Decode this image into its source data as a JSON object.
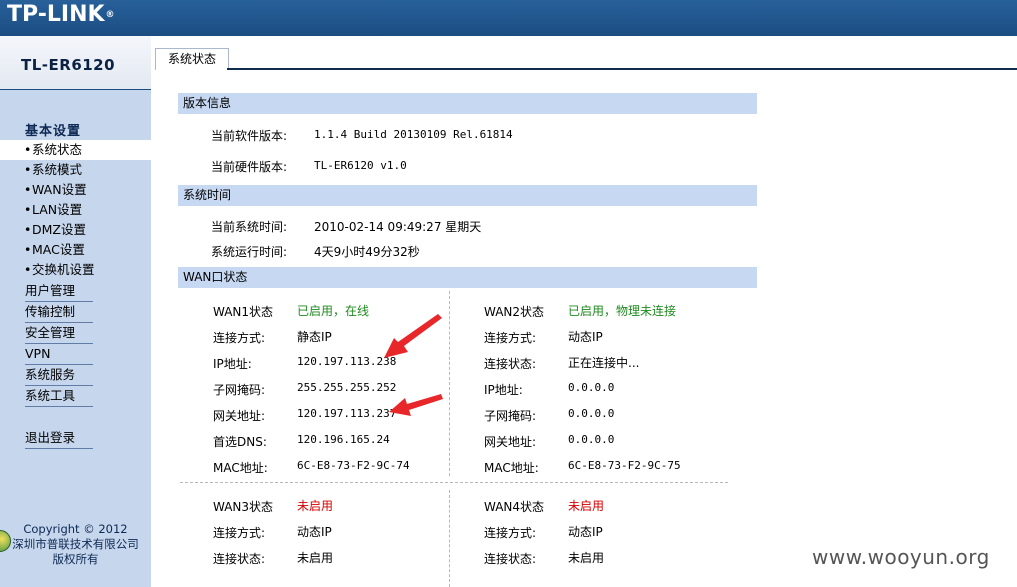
{
  "brand": {
    "logo": "TP-LINK",
    "reg": "®",
    "model": "TL-ER6120"
  },
  "tab": {
    "label": "系统状态"
  },
  "sidebar": {
    "heading": "基本设置",
    "sub_items": [
      {
        "label": "系统状态"
      },
      {
        "label": "系统模式"
      },
      {
        "label": "WAN设置"
      },
      {
        "label": "LAN设置"
      },
      {
        "label": "DMZ设置"
      },
      {
        "label": "MAC设置"
      },
      {
        "label": "交换机设置"
      }
    ],
    "main_items": [
      {
        "label": "用户管理"
      },
      {
        "label": "传输控制"
      },
      {
        "label": "安全管理"
      },
      {
        "label": "VPN"
      },
      {
        "label": "系统服务"
      },
      {
        "label": "系统工具"
      }
    ],
    "logout": "退出登录",
    "copyright_line1": "Copyright ©  2012",
    "copyright_line2": "深圳市普联技术有限公司",
    "copyright_line3": "版权所有",
    "bullet": "•"
  },
  "version": {
    "title": "版本信息",
    "software_label": "当前软件版本:",
    "software_value": "1.1.4 Build 20130109 Rel.61814",
    "hardware_label": "当前硬件版本:",
    "hardware_value": "TL-ER6120 v1.0"
  },
  "time": {
    "title": "系统时间",
    "current_label": "当前系统时间:",
    "current_value": "2010-02-14 09:49:27 星期天",
    "uptime_label": "系统运行时间:",
    "uptime_value": "4天9小时49分32秒"
  },
  "wan": {
    "title": "WAN口状态",
    "wan1": {
      "status_label": "WAN1状态",
      "status_value": "已启用，在线",
      "conn_type_label": "连接方式:",
      "conn_type_value": "静态IP",
      "ip_label": "IP地址:",
      "ip_value": "120.197.113.238",
      "mask_label": "子网掩码:",
      "mask_value": "255.255.255.252",
      "gw_label": "网关地址:",
      "gw_value": "120.197.113.237",
      "dns_label": "首选DNS:",
      "dns_value": "120.196.165.24",
      "mac_label": "MAC地址:",
      "mac_value": "6C-E8-73-F2-9C-74"
    },
    "wan2": {
      "status_label": "WAN2状态",
      "status_value": "已启用，物理未连接",
      "conn_type_label": "连接方式:",
      "conn_type_value": "动态IP",
      "conn_state_label": "连接状态:",
      "conn_state_value": "正在连接中...",
      "ip_label": "IP地址:",
      "ip_value": "0.0.0.0",
      "mask_label": "子网掩码:",
      "mask_value": "0.0.0.0",
      "gw_label": "网关地址:",
      "gw_value": "0.0.0.0",
      "mac_label": "MAC地址:",
      "mac_value": "6C-E8-73-F2-9C-75"
    },
    "wan3": {
      "status_label": "WAN3状态",
      "status_value": "未启用",
      "conn_type_label": "连接方式:",
      "conn_type_value": "动态IP",
      "conn_state_label": "连接状态:",
      "conn_state_value": "未启用"
    },
    "wan4": {
      "status_label": "WAN4状态",
      "status_value": "未启用",
      "conn_type_label": "连接方式:",
      "conn_type_value": "动态IP",
      "conn_state_label": "连接状态:",
      "conn_state_value": "未启用"
    }
  },
  "colors": {
    "banner": "#1b4d82",
    "section_bar": "#c6d8f2",
    "sidebar": "#c6d6ec",
    "online": "#1f8a1f",
    "disabled": "#d40000",
    "arrow": "#e8272b"
  },
  "watermark": "www.wooyun.org"
}
